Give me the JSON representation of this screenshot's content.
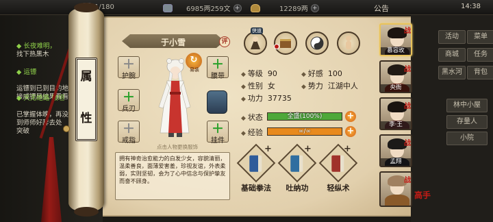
{
  "topbar": {
    "stamina": "1/180",
    "money": "6985两259文",
    "ingot": "12289两",
    "announcement": "公告",
    "clock": "14:38"
  },
  "quests": [
    {
      "title": "◆ 长夜难明，",
      "desc": "找下热黑木"
    },
    {
      "title": "◆ 运镖",
      "desc": "运镖到已到目的地，\n接威镖局结果看看"
    },
    {
      "title": "◆ 天无绝路 破坦",
      "desc": "已掌握体魄，再没\n到师师好辞去处\n突破"
    }
  ],
  "right_menu": [
    "活动",
    "菜单",
    "商城",
    "任务",
    "黑水河",
    "背包",
    "林中小屋",
    "存量人",
    "小院"
  ],
  "scroll_tag": [
    "属",
    "性"
  ],
  "character": {
    "name": "于小雪",
    "eval_label": "评",
    "change_label": "易装",
    "hint": "点击人物更换服饰",
    "slots_left": [
      {
        "label": "护腕",
        "state": "empty"
      },
      {
        "label": "兵刃",
        "state": "add"
      },
      {
        "label": "戒指",
        "state": "empty"
      }
    ],
    "slots_right": [
      {
        "label": "腰带",
        "state": "add"
      },
      {
        "label": "",
        "state": "armor"
      },
      {
        "label": "挂件",
        "state": "add"
      }
    ],
    "description": "拥有神奇治愈能力的白发少女，容貌清丽，温柔善良，面薄爱害羞，珍视友谊，外表柔弱，实则坚韧，会为了心中信念与保护挚友而奋不顾身。"
  },
  "stats": {
    "level_label": "等级",
    "level": "90",
    "fav_label": "好感",
    "fav": "100",
    "gender_label": "性别",
    "gender": "女",
    "faction_label": "势力",
    "faction": "江湖中人",
    "power_label": "功力",
    "power": "37735",
    "status_label": "状态",
    "status_text": "全盛(100%)",
    "status_fraction": 1.0,
    "exp_label": "经验",
    "exp_text": "∞/∞",
    "exp_fraction": 1.0
  },
  "top_icon_badge": "侠道",
  "arts": [
    {
      "label": "基础拳法",
      "color": "#2f5c9a"
    },
    {
      "label": "吐纳功",
      "color": "#2f6ea0"
    },
    {
      "label": "轻纵术",
      "color": "#a0322a"
    }
  ],
  "portraits": [
    {
      "name": "慕容玫",
      "mark": "战",
      "hair": "#1c1410",
      "body": "#3a2a2a"
    },
    {
      "name": "央衙",
      "mark": "战",
      "hair": "#221a14",
      "body": "#7a2a1e"
    },
    {
      "name": "李·王",
      "mark": "战",
      "hair": "#1a1410",
      "body": "#6a3a3a"
    },
    {
      "name": "孟翔",
      "mark": "战",
      "hair": "#1c1a18",
      "body": "#2a2a30"
    },
    {
      "name": "",
      "mark": "战",
      "hair": "#a08060",
      "body": "#8a5a2a"
    }
  ],
  "portrait_seal": "高手",
  "colors": {
    "status_fill": "#4ea83a",
    "exp_fill": "#e88a1e",
    "accent": "#c41c16"
  }
}
